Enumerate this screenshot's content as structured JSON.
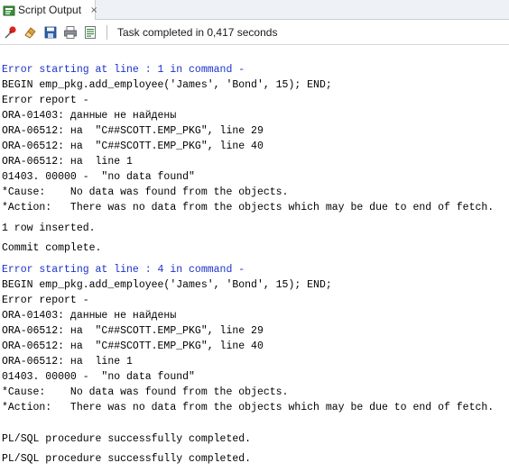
{
  "tab": {
    "label": "Script Output",
    "close_glyph": "×",
    "icon": "script-output-icon"
  },
  "toolbar": {
    "buttons": [
      "pin-icon",
      "eraser-icon",
      "save-icon",
      "print-icon",
      "export-icon"
    ],
    "status": "Task completed in 0,417 seconds"
  },
  "colors": {
    "error_header": "#1a32c8",
    "text": "#000000"
  },
  "output": {
    "lines": [
      "Error starting at line : 1 in command -",
      "BEGIN emp_pkg.add_employee('James', 'Bond', 15); END;",
      "Error report -",
      "ORA-01403: данные не найдены",
      "ORA-06512: на  \"C##SCOTT.EMP_PKG\", line 29",
      "ORA-06512: на  \"C##SCOTT.EMP_PKG\", line 40",
      "ORA-06512: на  line 1",
      "01403. 00000 -  \"no data found\"",
      "*Cause:    No data was found from the objects.",
      "*Action:   There was no data from the objects which may be due to end of fetch.",
      "1 row inserted.",
      "Commit complete.",
      "Error starting at line : 4 in command -",
      "BEGIN emp_pkg.add_employee('James', 'Bond', 15); END;",
      "Error report -",
      "ORA-01403: данные не найдены",
      "ORA-06512: на  \"C##SCOTT.EMP_PKG\", line 29",
      "ORA-06512: на  \"C##SCOTT.EMP_PKG\", line 40",
      "ORA-06512: на  line 1",
      "01403. 00000 -  \"no data found\"",
      "*Cause:    No data was found from the objects.",
      "*Action:   There was no data from the objects which may be due to end of fetch.",
      "PL/SQL procedure successfully completed.",
      "PL/SQL procedure successfully completed."
    ]
  }
}
